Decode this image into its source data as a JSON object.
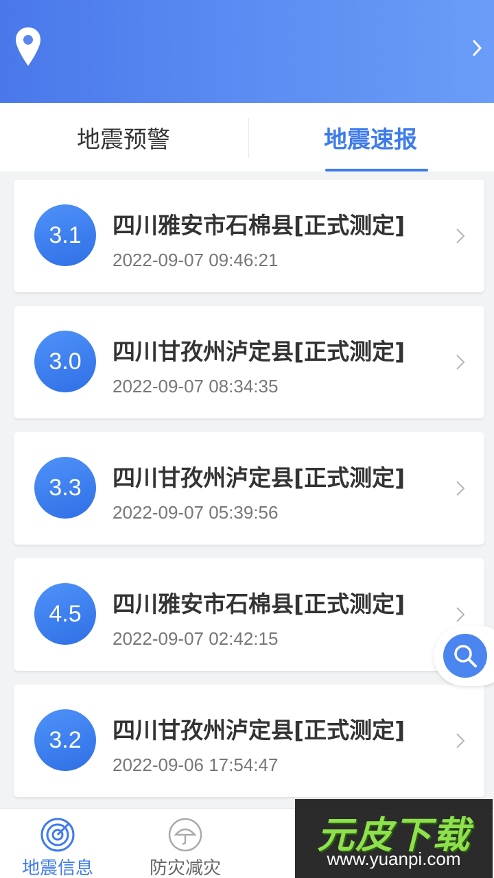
{
  "tabs": [
    {
      "label": "地震预警",
      "active": false
    },
    {
      "label": "地震速报",
      "active": true
    }
  ],
  "colors": {
    "accent": "#3e7bec",
    "header_gradient_start": "#4a78ea",
    "header_gradient_end": "#6a9cf8",
    "card_bg": "#ffffff",
    "page_bg": "#f2f3f5"
  },
  "header": {
    "location_icon": "location-pin-icon",
    "right_icon": "chevron-right-icon"
  },
  "quakes": [
    {
      "magnitude": "3.1",
      "place": "四川雅安市石棉县[正式测定]",
      "time": "2022-09-07 09:46:21"
    },
    {
      "magnitude": "3.0",
      "place": "四川甘孜州泸定县[正式测定]",
      "time": "2022-09-07 08:34:35"
    },
    {
      "magnitude": "3.3",
      "place": "四川甘孜州泸定县[正式测定]",
      "time": "2022-09-07 05:39:56"
    },
    {
      "magnitude": "4.5",
      "place": "四川雅安市石棉县[正式测定]",
      "time": "2022-09-07 02:42:15"
    },
    {
      "magnitude": "3.2",
      "place": "四川甘孜州泸定县[正式测定]",
      "time": "2022-09-06 17:54:47"
    }
  ],
  "search_fab": {
    "icon": "search-icon"
  },
  "bottom_nav": [
    {
      "label": "地震信息",
      "icon": "radar-icon",
      "active": true
    },
    {
      "label": "防灾减灾",
      "icon": "umbrella-icon",
      "active": false
    }
  ],
  "watermark": {
    "title": "元皮下载",
    "url": "www.yuanpi.com"
  }
}
